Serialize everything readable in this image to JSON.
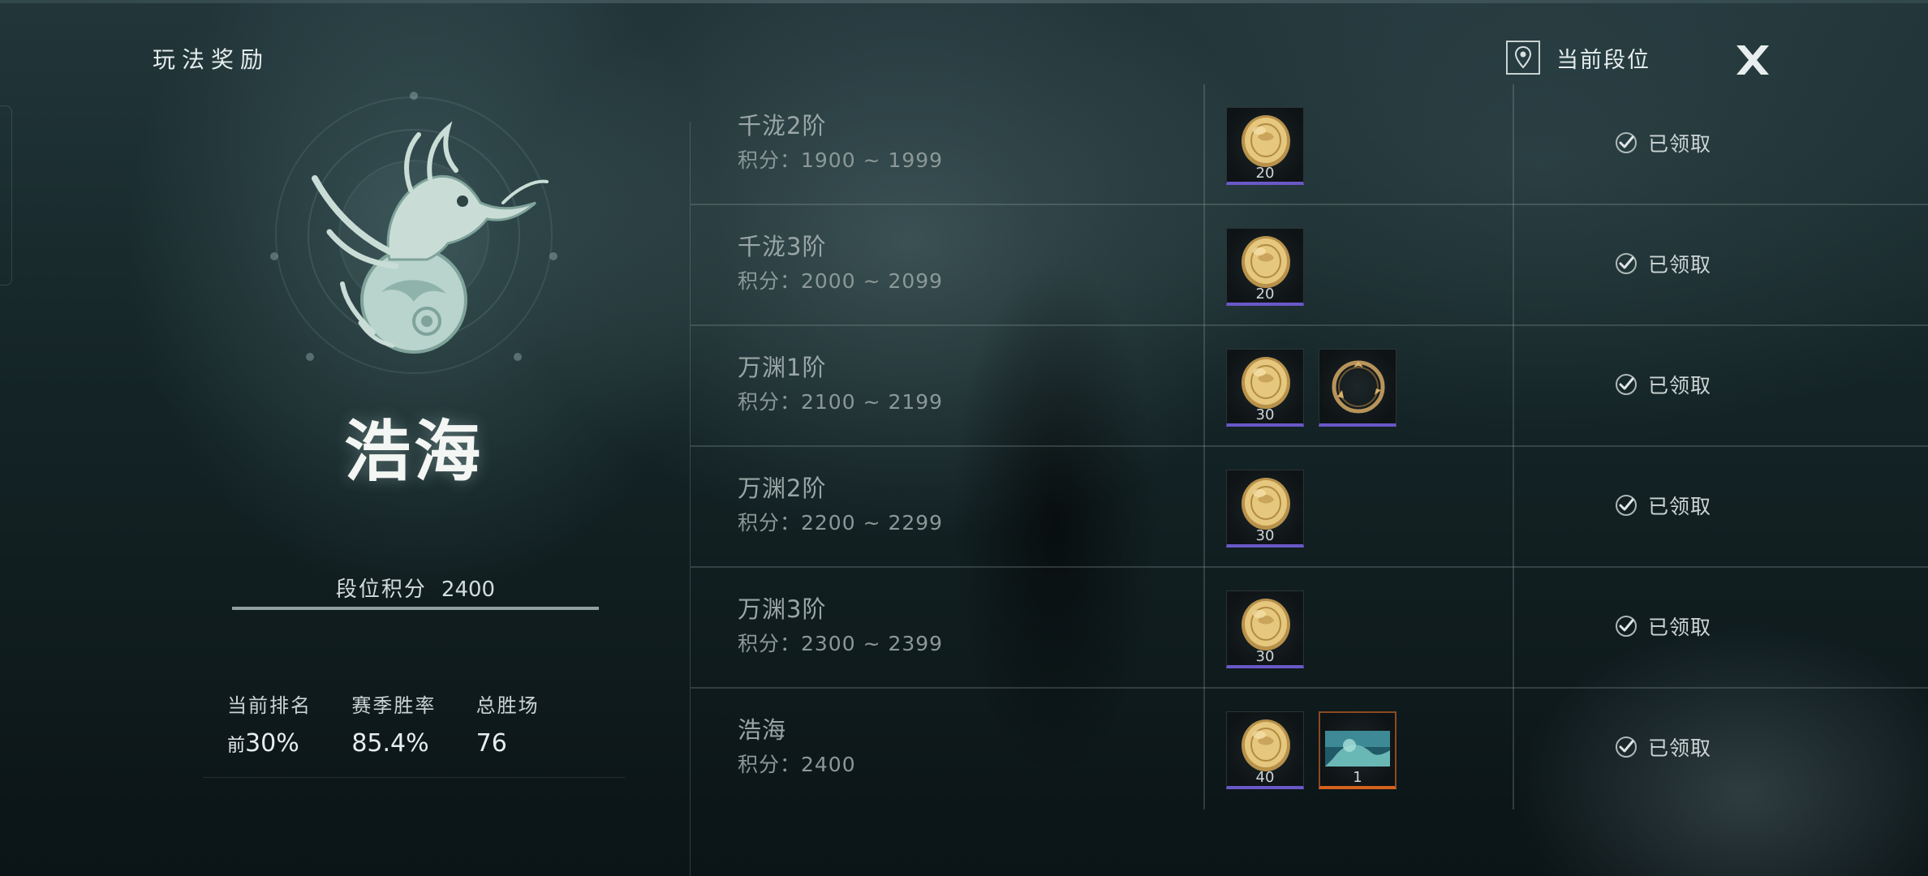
{
  "header": {
    "title": "玩法奖励",
    "current_rank_label": "当前段位"
  },
  "rank": {
    "name": "浩海",
    "score_label": "段位积分",
    "score_value": "2400"
  },
  "stats": [
    {
      "label": "当前排名",
      "prefix": "前",
      "value": "30%"
    },
    {
      "label": "赛季胜率",
      "prefix": "",
      "value": "85.4%"
    },
    {
      "label": "总胜场",
      "prefix": "",
      "value": "76"
    }
  ],
  "rewards": [
    {
      "tier": "千泷2阶",
      "range": "积分：1900 ~ 1999",
      "items": [
        {
          "icon": "gold-coin-icon",
          "qty": "20",
          "rarity": "purple"
        }
      ],
      "status": "已领取"
    },
    {
      "tier": "千泷3阶",
      "range": "积分：2000 ~ 2099",
      "items": [
        {
          "icon": "gold-coin-icon",
          "qty": "20",
          "rarity": "purple"
        }
      ],
      "status": "已领取"
    },
    {
      "tier": "万渊1阶",
      "range": "积分：2100 ~ 2199",
      "items": [
        {
          "icon": "gold-coin-icon",
          "qty": "30",
          "rarity": "purple"
        },
        {
          "icon": "dragon-ring-frame-icon",
          "qty": "",
          "rarity": "purple"
        }
      ],
      "status": "已领取"
    },
    {
      "tier": "万渊2阶",
      "range": "积分：2200 ~ 2299",
      "items": [
        {
          "icon": "gold-coin-icon",
          "qty": "30",
          "rarity": "purple"
        }
      ],
      "status": "已领取"
    },
    {
      "tier": "万渊3阶",
      "range": "积分：2300 ~ 2399",
      "items": [
        {
          "icon": "gold-coin-icon",
          "qty": "30",
          "rarity": "purple"
        }
      ],
      "status": "已领取"
    },
    {
      "tier": "浩海",
      "range": "积分：2400",
      "items": [
        {
          "icon": "gold-coin-icon",
          "qty": "40",
          "rarity": "purple"
        },
        {
          "icon": "scene-card-icon",
          "qty": "1",
          "rarity": "orange"
        }
      ],
      "status": "已领取"
    }
  ]
}
